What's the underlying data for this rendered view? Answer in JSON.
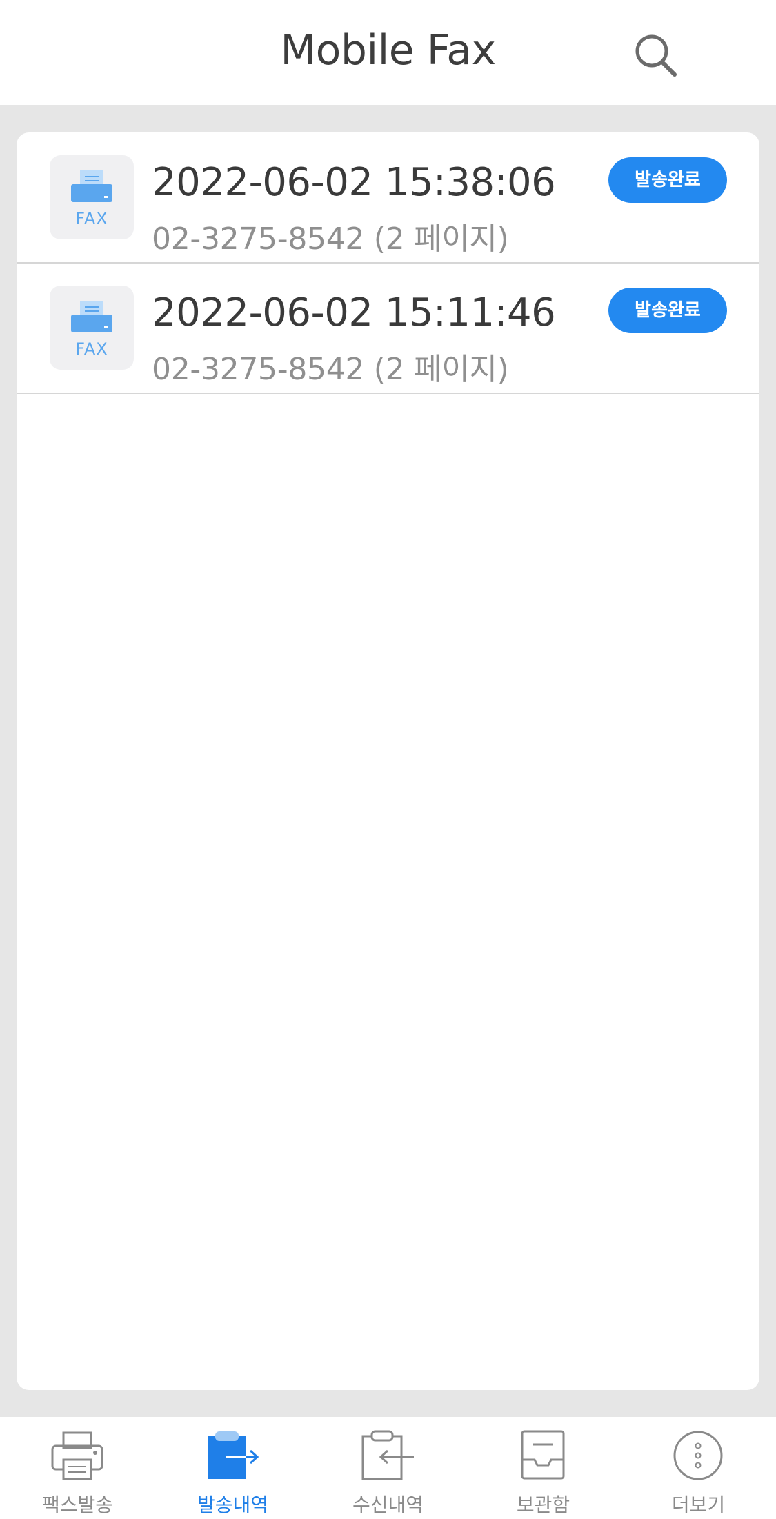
{
  "header": {
    "title": "Mobile Fax",
    "search_icon": "search-icon"
  },
  "sent_list": [
    {
      "date": "2022-06-02 15:38:06",
      "number": "02-3275-8542 (2 페이지)",
      "status": "발송완료",
      "icon_label": "FAX"
    },
    {
      "date": "2022-06-02 15:11:46",
      "number": "02-3275-8542 (2 페이지)",
      "status": "발송완료",
      "icon_label": "FAX"
    }
  ],
  "tabs": [
    {
      "label": "팩스발송",
      "icon": "printer-icon",
      "active": false
    },
    {
      "label": "발송내역",
      "icon": "sent-clipboard-icon",
      "active": true
    },
    {
      "label": "수신내역",
      "icon": "received-clipboard-icon",
      "active": false
    },
    {
      "label": "보관함",
      "icon": "archive-tray-icon",
      "active": false
    },
    {
      "label": "더보기",
      "icon": "more-dots-icon",
      "active": false
    }
  ],
  "colors": {
    "accent": "#2389f0",
    "active_tab": "#1f7fe8",
    "inactive_tab": "#8a8a8a",
    "background": "#e6e6e6"
  }
}
